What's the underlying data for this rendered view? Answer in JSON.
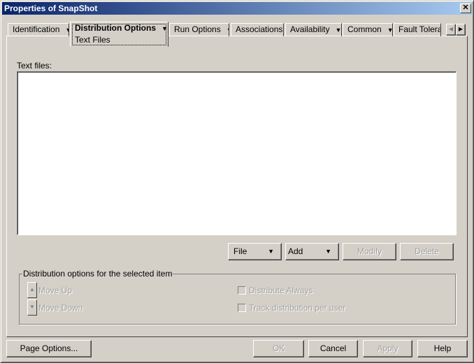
{
  "window": {
    "title": "Properties of SnapShot",
    "close": "✕"
  },
  "tabs": [
    {
      "label": "Identification",
      "dropdown": true
    },
    {
      "label": "Distribution Options",
      "dropdown": true,
      "active": true,
      "subtab": "Text Files"
    },
    {
      "label": "Run Options",
      "dropdown": true
    },
    {
      "label": "Associations",
      "dropdown": false
    },
    {
      "label": "Availability",
      "dropdown": true
    },
    {
      "label": "Common",
      "dropdown": true
    },
    {
      "label": "Fault Toleran",
      "dropdown": false
    }
  ],
  "tab_scroll": {
    "left": "◀",
    "right": "▶"
  },
  "text_files": {
    "label": "Text files:",
    "items": []
  },
  "list_buttons": {
    "file": "File",
    "add": "Add",
    "modify": "Modify",
    "delete": "Delete"
  },
  "group": {
    "title": "Distribution options for the selected item",
    "move_up": "Move Up",
    "move_down": "Move Down",
    "distribute_always": "Distribute Always",
    "track": "Track distribution per user"
  },
  "footer": {
    "page_options": "Page Options...",
    "ok": "OK",
    "cancel": "Cancel",
    "apply": "Apply",
    "help": "Help"
  }
}
